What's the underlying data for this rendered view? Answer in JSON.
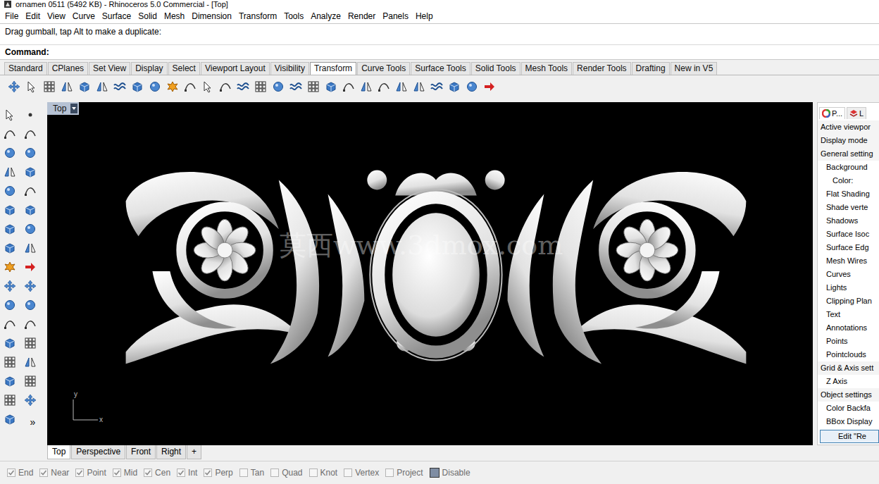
{
  "window": {
    "title": "ornamen 0511 (5492 KB) - Rhinoceros 5.0 Commercial - [Top]"
  },
  "menu": [
    "File",
    "Edit",
    "View",
    "Curve",
    "Surface",
    "Solid",
    "Mesh",
    "Dimension",
    "Transform",
    "Tools",
    "Analyze",
    "Render",
    "Panels",
    "Help"
  ],
  "command": {
    "prompt": "Drag gumball, tap Alt to make a duplicate:",
    "label": "Command:"
  },
  "toolbar_tabs": [
    {
      "label": "Standard",
      "selected": false
    },
    {
      "label": "CPlanes",
      "selected": false
    },
    {
      "label": "Set View",
      "selected": false
    },
    {
      "label": "Display",
      "selected": false
    },
    {
      "label": "Select",
      "selected": false
    },
    {
      "label": "Viewport Layout",
      "selected": false
    },
    {
      "label": "Visibility",
      "selected": false
    },
    {
      "label": "Transform",
      "selected": true
    },
    {
      "label": "Curve Tools",
      "selected": false
    },
    {
      "label": "Surface Tools",
      "selected": false
    },
    {
      "label": "Solid Tools",
      "selected": false
    },
    {
      "label": "Mesh Tools",
      "selected": false
    },
    {
      "label": "Render Tools",
      "selected": false
    },
    {
      "label": "Drafting",
      "selected": false
    },
    {
      "label": "New in V5",
      "selected": false
    }
  ],
  "left_toolbar": {
    "more": "»"
  },
  "viewport": {
    "label": "Top",
    "watermark": "莫西www.3dmox.com",
    "axis": {
      "x": "x",
      "y": "y"
    }
  },
  "panel": {
    "tabs": [
      {
        "label": "P...",
        "selected": true
      },
      {
        "label": "L",
        "selected": false
      }
    ],
    "items": [
      {
        "label": "Active viewpor",
        "kind": "section"
      },
      {
        "label": "Display mode",
        "kind": "section"
      },
      {
        "label": "General setting",
        "kind": "section"
      },
      {
        "label": "Background",
        "kind": "item"
      },
      {
        "label": "Color:",
        "kind": "subitem"
      },
      {
        "label": "Flat Shading",
        "kind": "item"
      },
      {
        "label": "Shade verte",
        "kind": "item"
      },
      {
        "label": "Shadows",
        "kind": "item"
      },
      {
        "label": "Surface Isoc",
        "kind": "item"
      },
      {
        "label": "Surface Edg",
        "kind": "item"
      },
      {
        "label": "Mesh Wires",
        "kind": "item"
      },
      {
        "label": "Curves",
        "kind": "item"
      },
      {
        "label": "Lights",
        "kind": "item"
      },
      {
        "label": "Clipping Plan",
        "kind": "item"
      },
      {
        "label": "Text",
        "kind": "item"
      },
      {
        "label": "Annotations",
        "kind": "item"
      },
      {
        "label": "Points",
        "kind": "item"
      },
      {
        "label": "Pointclouds",
        "kind": "item"
      },
      {
        "label": "Grid & Axis sett",
        "kind": "section"
      },
      {
        "label": "Z Axis",
        "kind": "item"
      },
      {
        "label": "Object settings",
        "kind": "section"
      },
      {
        "label": "Color Backfa",
        "kind": "item"
      },
      {
        "label": "BBox Display",
        "kind": "item"
      }
    ],
    "button": "Edit \"Re"
  },
  "viewport_tabs": [
    {
      "label": "Top",
      "selected": true
    },
    {
      "label": "Perspective",
      "selected": false
    },
    {
      "label": "Front",
      "selected": false
    },
    {
      "label": "Right",
      "selected": false
    },
    {
      "label": "+",
      "selected": false
    }
  ],
  "osnaps": [
    {
      "label": "End",
      "checked": true,
      "kind": "check"
    },
    {
      "label": "Near",
      "checked": true,
      "kind": "check"
    },
    {
      "label": "Point",
      "checked": true,
      "kind": "check"
    },
    {
      "label": "Mid",
      "checked": true,
      "kind": "check"
    },
    {
      "label": "Cen",
      "checked": true,
      "kind": "check"
    },
    {
      "label": "Int",
      "checked": true,
      "kind": "check"
    },
    {
      "label": "Perp",
      "checked": true,
      "kind": "check"
    },
    {
      "label": "Tan",
      "checked": false,
      "kind": "check"
    },
    {
      "label": "Quad",
      "checked": false,
      "kind": "check"
    },
    {
      "label": "Knot",
      "checked": false,
      "kind": "check"
    },
    {
      "label": "Vertex",
      "checked": false,
      "kind": "check"
    },
    {
      "label": "Project",
      "checked": false,
      "kind": "check"
    },
    {
      "label": "Disable",
      "checked": false,
      "kind": "toggle"
    }
  ]
}
